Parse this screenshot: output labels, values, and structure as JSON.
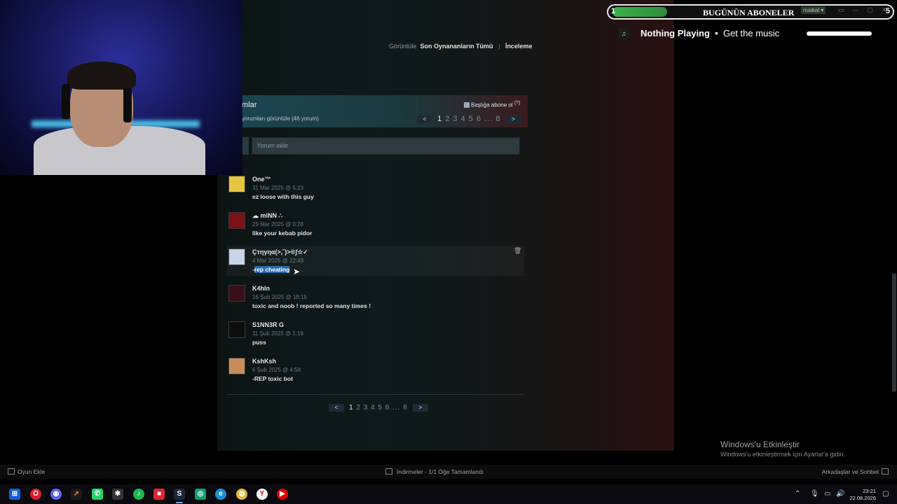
{
  "overlay": {
    "subs_left": "1",
    "subs_title": "BUGÜNÜN ABONELER",
    "subs_right": "5",
    "user_chip": "nuskal ▾",
    "now_playing": "Nothing Playing",
    "now_playing_sub": "Get the music",
    "np_icon": "♫"
  },
  "steam": {
    "top_links": {
      "view_label": "Görüntüle",
      "recent_games": "Son Oynananların Tümü",
      "review": "İnceleme"
    },
    "comments": {
      "title": "mlar",
      "subscribe_label": "Başlığa abone ol",
      "help": "(?)",
      "view_all": "yorumları görüntüle (46 yorum)",
      "input_placeholder": "Yorum ekle",
      "pager_top": {
        "prev": "<",
        "current": "1",
        "pages": "2 3 4 5 6 ... 8",
        "next": ">"
      },
      "pager_bottom": {
        "prev": "<",
        "current": "1",
        "pages": "2 3 4 5 6 ... 8",
        "next": ">"
      },
      "items": [
        {
          "author": "One™",
          "date": "31 Mar 2025 @ 5:23",
          "text": "ez loose with this guy",
          "avatar_color": "#e6c640"
        },
        {
          "author": "☁ miNN ∴",
          "date": "29 Mar 2025 @ 0:28",
          "text": "like your kebab pidor",
          "avatar_color": "#7a1218"
        },
        {
          "author": "Çтηγηα(>,˘)>®ʃ☆✓",
          "date": "4 Mar 2025 @ 22:49",
          "text_prefix": "-",
          "text_selected": "rep cheating",
          "avatar_color": "#c9d4e6"
        },
        {
          "author": "K4hIn",
          "date": "16 Şub 2025 @ 18:15",
          "text": "toxic and noob ! reported so many times !",
          "avatar_color": "#3a0f1a"
        },
        {
          "author": "S1NN3R G",
          "date": "11 Şub 2025 @ 1:19",
          "text": "puss",
          "avatar_color": "#0e0e0e"
        },
        {
          "author": "KshKsh",
          "date": "6 Şub 2025 @ 4:58",
          "text": "-REP toxic bot",
          "avatar_color": "#c98d5a"
        }
      ]
    },
    "bottom": {
      "add_game": "Oyun Ekle",
      "downloads": "İndirmeler - 1/1 Öğe Tamamlandı",
      "friends": "Arkadaşlar ve Sohbet"
    }
  },
  "windows": {
    "activate_title": "Windows'u Etkinleştir",
    "activate_sub": "Windows'u etkinleştirmek için Ayarlar'a gidin.",
    "clock_time": "23:21",
    "clock_date": "22.08.2026"
  },
  "taskbar_icons": [
    {
      "name": "windows-start-icon",
      "glyph": "⊞",
      "color": "#1e90ff"
    },
    {
      "name": "opera-icon",
      "glyph": "O",
      "color": "#d9202c"
    },
    {
      "name": "discord-icon",
      "glyph": "◉",
      "color": "#5865f2"
    },
    {
      "name": "app-arrow-icon",
      "glyph": "➚",
      "color": "#1b1b1b"
    },
    {
      "name": "whatsapp-icon",
      "glyph": "✆",
      "color": "#25d366"
    },
    {
      "name": "tool-icon",
      "glyph": "✱",
      "color": "#333333"
    },
    {
      "name": "spotify-icon",
      "glyph": "♪",
      "color": "#1db954"
    },
    {
      "name": "app-red-icon",
      "glyph": "■",
      "color": "#e0242e"
    },
    {
      "name": "steam-icon",
      "glyph": "S",
      "color": "#1b2838"
    },
    {
      "name": "xbox-icon",
      "glyph": "◎",
      "color": "#10a070"
    },
    {
      "name": "edge-icon",
      "glyph": "e",
      "color": "#1a8fd6"
    },
    {
      "name": "chrome-icon",
      "glyph": "◍",
      "color": "#e6b83a"
    },
    {
      "name": "yandex-icon",
      "glyph": "Y",
      "color": "#fafafa"
    },
    {
      "name": "youtube-icon",
      "glyph": "▶",
      "color": "#e00000"
    }
  ]
}
